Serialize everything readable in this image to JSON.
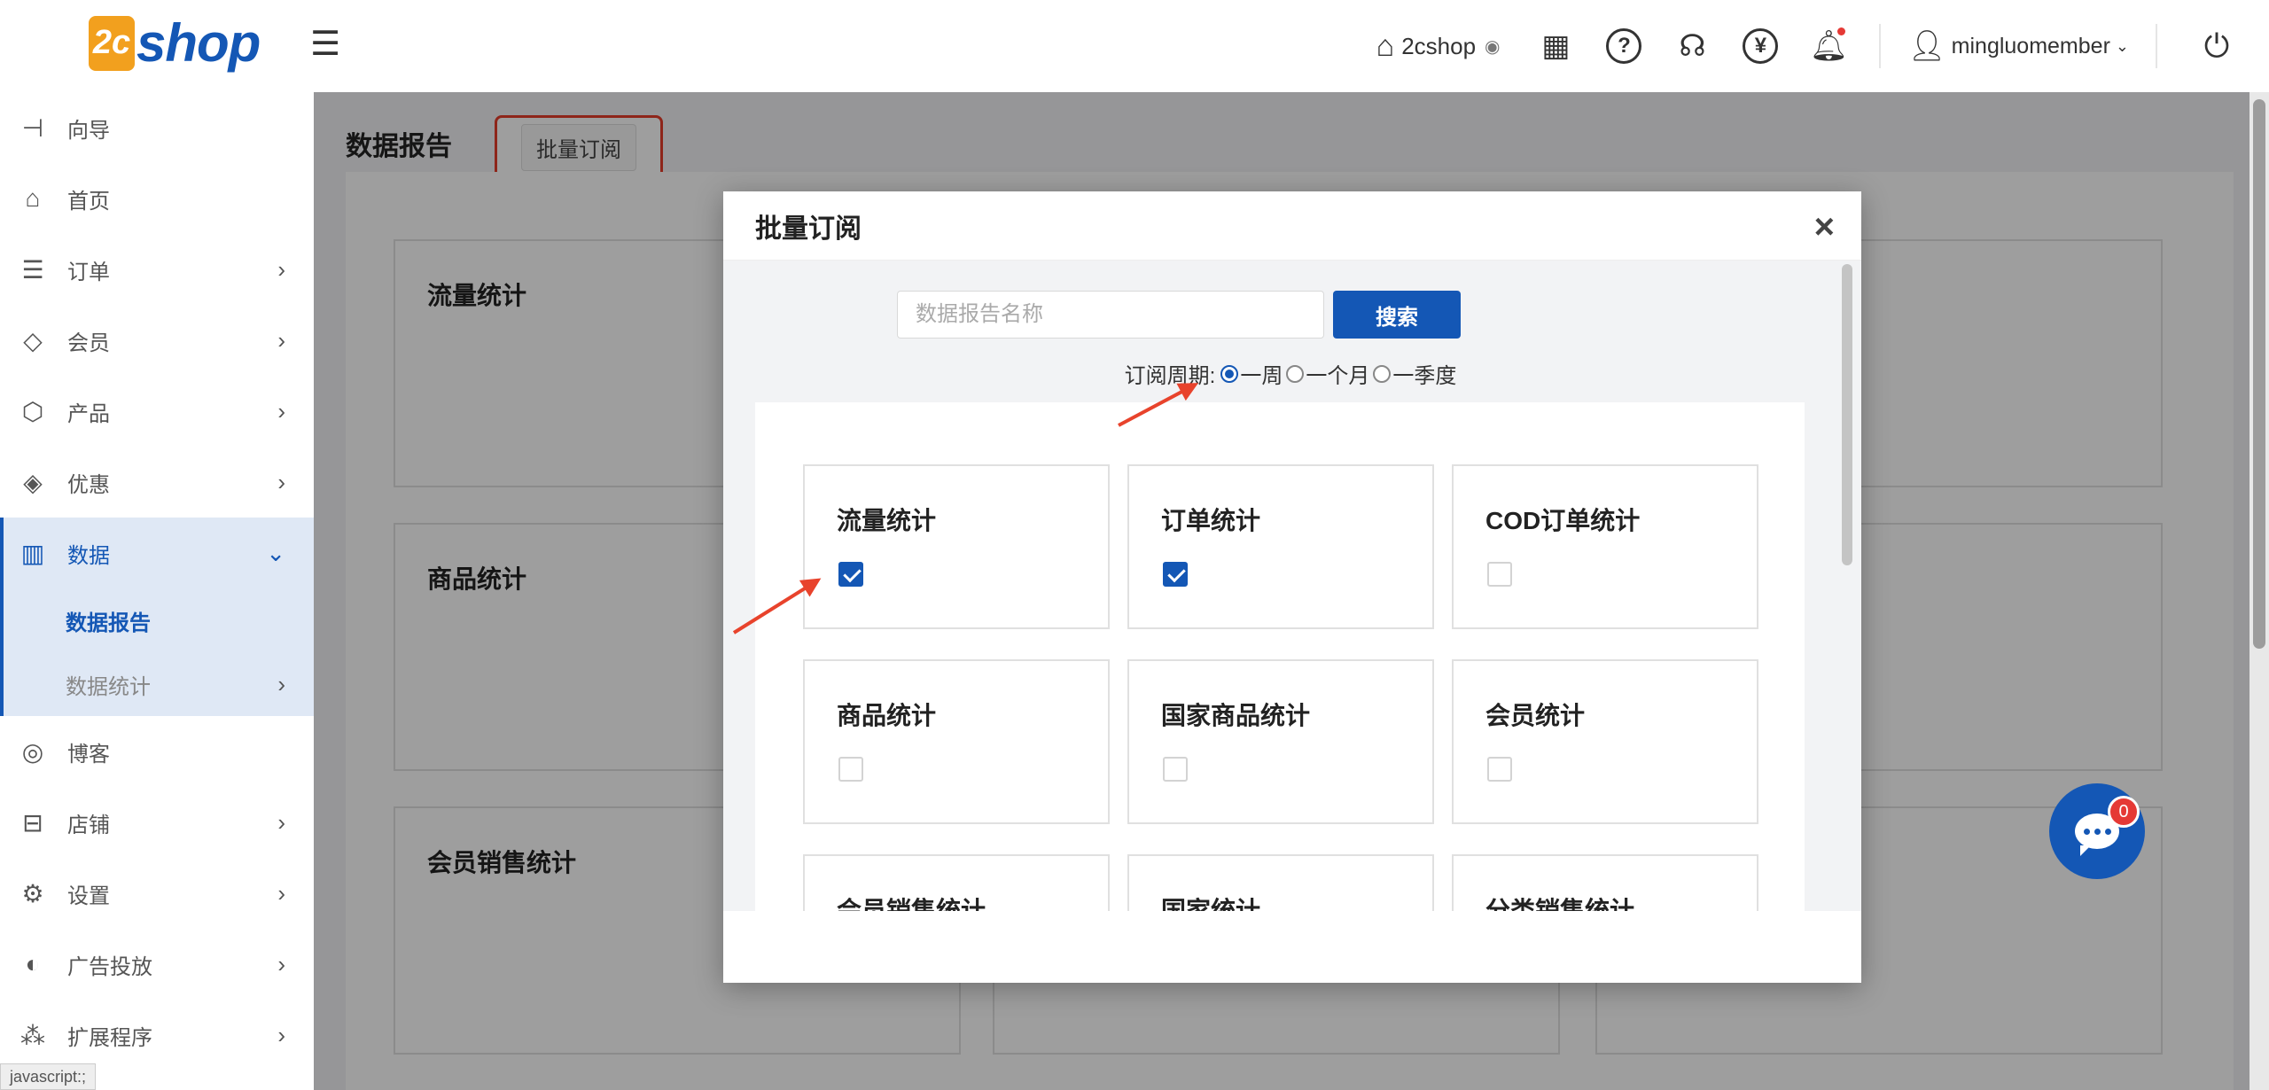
{
  "header": {
    "logo_mark": "2c",
    "logo_text": "shop",
    "store_name": "2cshop",
    "username": "mingluomember",
    "icons": [
      "qrcode-icon",
      "help-icon",
      "headset-icon",
      "currency-icon",
      "bell-icon",
      "power-icon"
    ]
  },
  "sidebar": {
    "items": [
      {
        "label": "向导",
        "icon": "signpost-icon",
        "arrow": false
      },
      {
        "label": "首页",
        "icon": "home-icon",
        "arrow": false
      },
      {
        "label": "订单",
        "icon": "order-icon",
        "arrow": true
      },
      {
        "label": "会员",
        "icon": "diamond-icon",
        "arrow": true
      },
      {
        "label": "产品",
        "icon": "box-icon",
        "arrow": true
      },
      {
        "label": "优惠",
        "icon": "tag-icon",
        "arrow": true
      },
      {
        "label": "数据",
        "icon": "chart-icon",
        "arrow": true,
        "expanded": true
      },
      {
        "label": "博客",
        "icon": "blog-icon",
        "arrow": false
      },
      {
        "label": "店铺",
        "icon": "store-icon",
        "arrow": true
      },
      {
        "label": "设置",
        "icon": "gear-icon",
        "arrow": true
      },
      {
        "label": "广告投放",
        "icon": "target-icon",
        "arrow": true
      },
      {
        "label": "扩展程序",
        "icon": "extension-icon",
        "arrow": true
      }
    ],
    "sub_items": [
      {
        "label": "数据报告",
        "current": true
      },
      {
        "label": "数据统计",
        "current": false
      }
    ]
  },
  "status_bar": "javascript:;",
  "main": {
    "title": "数据报告",
    "bulk_button": "批量订阅",
    "cards": [
      "流量统计",
      "商品统计",
      "会员销售统计"
    ]
  },
  "modal": {
    "title": "批量订阅",
    "close": "×",
    "search_placeholder": "数据报告名称",
    "search_button": "搜索",
    "period_label": "订阅周期:",
    "periods": [
      {
        "label": "一周",
        "checked": true
      },
      {
        "label": "一个月",
        "checked": false
      },
      {
        "label": "一季度",
        "checked": false
      }
    ],
    "options": [
      {
        "label": "流量统计",
        "checked": true
      },
      {
        "label": "订单统计",
        "checked": true
      },
      {
        "label": "COD订单统计",
        "checked": false
      },
      {
        "label": "商品统计",
        "checked": false
      },
      {
        "label": "国家商品统计",
        "checked": false
      },
      {
        "label": "会员统计",
        "checked": false
      },
      {
        "label": "会员销售统计",
        "checked": false
      },
      {
        "label": "国家统计",
        "checked": false
      },
      {
        "label": "分类销售统计",
        "checked": false
      }
    ]
  },
  "chat": {
    "badge": "0"
  },
  "colors": {
    "primary": "#1457b5",
    "highlight": "#e53c2b",
    "arrow": "#e8432c"
  }
}
